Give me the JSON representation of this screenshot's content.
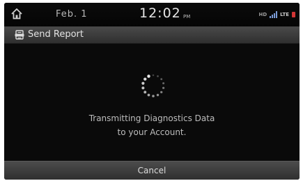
{
  "status_bar": {
    "date": "Feb. 1",
    "time": "12:02",
    "meridiem": "PM",
    "indicators": {
      "hd": "HD",
      "network": "LTE"
    },
    "icons": [
      "home-icon",
      "signal-icon",
      "alert-icon"
    ]
  },
  "header": {
    "icon": "report-icon",
    "title": "Send Report"
  },
  "main": {
    "spinner": "loading-spinner-icon",
    "message_line1": "Transmitting Diagnostics Data",
    "message_line2": "to your Account."
  },
  "footer": {
    "cancel_label": "Cancel"
  },
  "colors": {
    "background": "#0a0a0a",
    "bar": "#3d3d3d",
    "text": "#bdbdbd",
    "alert": "#d23535"
  }
}
